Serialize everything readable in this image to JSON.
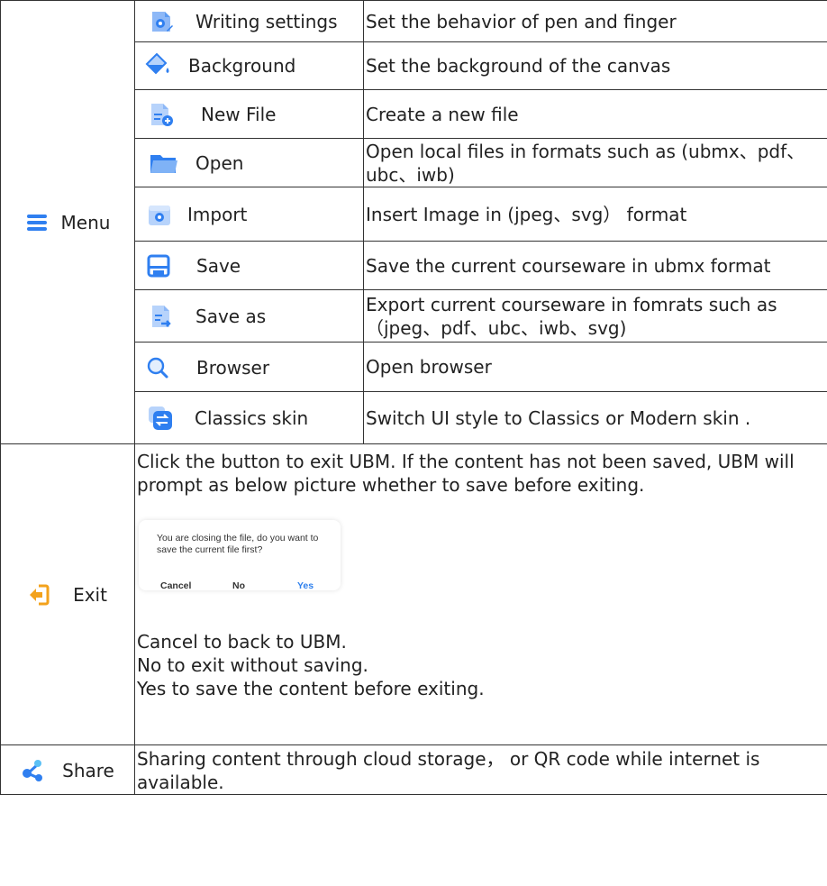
{
  "menu": {
    "label": "Menu",
    "items": [
      {
        "name": "Writing settings",
        "desc": "Set the behavior of pen and finger",
        "icon": "writing-settings-icon"
      },
      {
        "name": "Background",
        "desc": "Set the background of the canvas",
        "icon": "paint-bucket-icon"
      },
      {
        "name": "New File",
        "desc": "Create a new file",
        "icon": "new-file-icon"
      },
      {
        "name": "Open",
        "desc": "Open local files in formats such as (ubmx、pdf、ubc、iwb)",
        "icon": "folder-icon"
      },
      {
        "name": "Import",
        "desc": " Insert Image in (jpeg、svg） format",
        "icon": "import-image-icon"
      },
      {
        "name": "Save",
        "desc": "Save the current courseware in ubmx format",
        "icon": "save-icon"
      },
      {
        "name": "Save as",
        "desc": "Export current courseware in fomrats such as（jpeg、pdf、ubc、iwb、svg)",
        "icon": "save-as-icon"
      },
      {
        "name": "Browser",
        "desc": "Open browser",
        "icon": "search-icon"
      },
      {
        "name": "Classics skin",
        "desc": "Switch UI style to Classics or Modern skin .",
        "icon": "switch-skin-icon"
      }
    ]
  },
  "exit": {
    "label": "Exit",
    "text": "Click the button to exit UBM. If the content has not been saved, UBM will prompt as below picture whether to save before exiting.",
    "dialog": {
      "message": "You are closing the file, do you want to save the current file first?",
      "cancel": "Cancel",
      "no": "No",
      "yes": "Yes"
    },
    "lines": [
      "Cancel to back to UBM.",
      "No to exit without saving.",
      "Yes to save the content before exiting."
    ]
  },
  "share": {
    "label": "Share",
    "text": " Sharing content through cloud storage， or QR code while internet is available."
  },
  "colors": {
    "accent": "#2f7ff0",
    "exit_icon": "#f3a21c",
    "yes": "#2f80ed"
  }
}
